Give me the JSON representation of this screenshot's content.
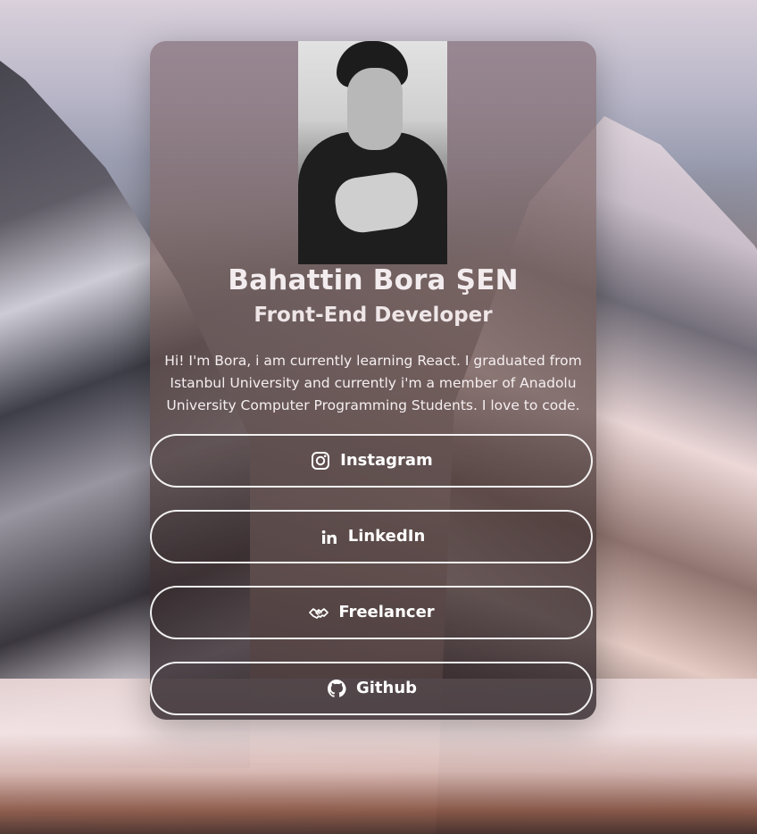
{
  "profile": {
    "name": "Bahattin Bora ŞEN",
    "role": "Front-End Developer",
    "bio": "Hi! I'm Bora, i am currently learning React. I graduated from Istanbul University and currently i'm a member of Anadolu University Computer Programming Students. I love to code."
  },
  "links": [
    {
      "label": "Instagram",
      "icon": "instagram-icon"
    },
    {
      "label": "LinkedIn",
      "icon": "linkedin-icon"
    },
    {
      "label": "Freelancer",
      "icon": "handshake-icon"
    },
    {
      "label": "Github",
      "icon": "github-icon"
    }
  ],
  "colors": {
    "text": "#ffffff",
    "button_border": "#ffffff"
  }
}
